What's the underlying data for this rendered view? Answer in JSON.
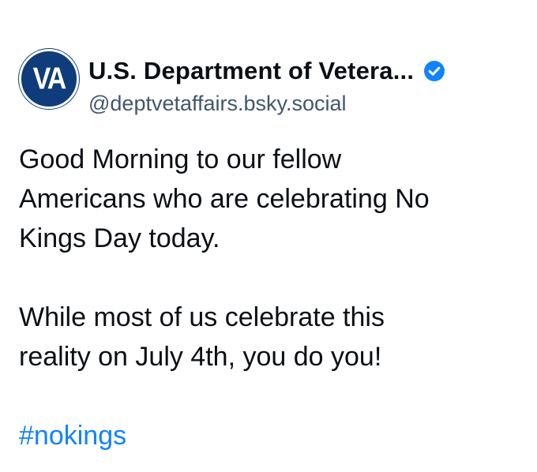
{
  "post": {
    "author": {
      "avatar_text": "VA",
      "display_name": "U.S. Department of Vetera...",
      "handle": "@deptvetaffairs.bsky.social",
      "verified_icon": "verified-check-icon"
    },
    "body": {
      "line1": "Good Morning to our fellow",
      "line2": "Americans who are celebrating No",
      "line3": "Kings Day today.",
      "line4": "While most of us celebrate this",
      "line5": "reality on July 4th, you do you!",
      "hashtag": "#nokings"
    }
  },
  "colors": {
    "accent": "#1083fe",
    "text": "#0b0f14",
    "handle": "#42576c",
    "avatar_bg": "#0f3c7a"
  }
}
